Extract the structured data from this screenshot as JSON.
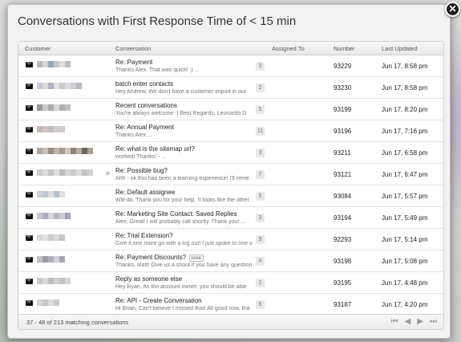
{
  "modal": {
    "title": "Conversations with First Response Time of < 15 min",
    "close_glyph": "✕"
  },
  "table": {
    "headers": {
      "customer": "Customer",
      "conversation": "Conversation",
      "assigned_to": "Assigned To",
      "number": "Number",
      "last_updated": "Last Updated"
    },
    "rows": [
      {
        "subject": "Re: Payment",
        "preview": "Thanks Alex. That was quick! :) ...",
        "count": "3",
        "number": "93229",
        "updated": "Jun 17, 8:58 pm",
        "customer_colors": [
          "#b8b8b8",
          "#d6d6d6",
          "#9aa6b8",
          "#c9c9c9",
          "#dedede",
          "#bcbcbc"
        ]
      },
      {
        "subject": "batch enter contacts",
        "preview": "Hey Andrew, We don't have a customer import in our",
        "count": "2",
        "number": "93230",
        "updated": "Jun 17, 8:58 pm",
        "customer_colors": [
          "#c7c7d6",
          "#d9d9d9",
          "#b6b0c2",
          "#e2e2e2",
          "#c8c8c8",
          "#dddddd",
          "#cfcfcf",
          "#b8b8c8"
        ]
      },
      {
        "subject": "Recent conversations",
        "preview": "You're always welcome :) Best Regards, Leonardo D",
        "count": "5",
        "number": "93199",
        "updated": "Jun 17, 8:20 pm",
        "customer_colors": [
          "#9a9a9a",
          "#cacaca",
          "#a9a9a9",
          "#d8d8d8",
          "#b3b3b3",
          "#c1c1c1"
        ]
      },
      {
        "subject": "Re: Annual Payment",
        "preview": "Thanks Alex ...",
        "count": "11",
        "number": "93196",
        "updated": "Jun 17, 7:16 pm",
        "customer_colors": [
          "#c7b8b8",
          "#d2c3c3",
          "#bfbfbf",
          "#cfcfcf",
          "#d9c9c9"
        ]
      },
      {
        "subject": "Re: what is the sitemap url?",
        "preview": "worked! Thanks! - ...",
        "count": "3",
        "number": "93211",
        "updated": "Jun 17, 6:58 pm",
        "customer_colors": [
          "#b0a8a0",
          "#c8c0b8",
          "#9a8f86",
          "#bfb5aa",
          "#a59a8f",
          "#cfc6bd",
          "#8f857b",
          "#b7ada3",
          "#6f655c",
          "#a99f95"
        ]
      },
      {
        "subject": "Re: Possible bug?",
        "preview": "Ahh - ok this has been a learning experience! I'll reme",
        "count": "7",
        "number": "93121",
        "updated": "Jun 17, 6:47 pm",
        "customer_colors": [
          "#cfcfcf",
          "#dadada",
          "#c5c5c5",
          "#e0e0e0",
          "#bebebe",
          "#d7d7d7",
          "#cacaca",
          "#dedede",
          "#c3c3c3",
          "#d1d1d1"
        ]
      },
      {
        "subject": "Re: Default assignee",
        "preview": "Will-do. Thank you for your help. It looks like the other",
        "count": "5",
        "number": "93084",
        "updated": "Jun 17, 5:57 pm",
        "customer_colors": [
          "#d0d0d0",
          "#c0c8d8",
          "#dcdcdc",
          "#b8c0d0",
          "#e0e0e0"
        ]
      },
      {
        "subject": "Re: Marketing Site Contact: Saved Replies",
        "preview": "Alex, Great! I will probably call shortly. Thank you! ...",
        "count": "3",
        "number": "93194",
        "updated": "Jun 17, 5:49 pm",
        "customer_colors": [
          "#c8c8c8",
          "#a8b0c0",
          "#d5d5d5",
          "#b5b5c5",
          "#cbcbcb",
          "#9ea6b6"
        ]
      },
      {
        "subject": "Re: Trial Extension?",
        "preview": "Give it one more go with a log out! I just spoke to one o",
        "count": "9",
        "number": "92293",
        "updated": "Jun 17, 5:14 pm",
        "customer_colors": [
          "#d6d6d6",
          "#e1e1e1",
          "#cbcbcb",
          "#dadada",
          "#c4c4c4"
        ]
      },
      {
        "subject": "Re: Payment Discounts?",
        "tag": "love",
        "preview": "Thanks, Matt! Give us a shout if you have any question",
        "count": "4",
        "number": "93198",
        "updated": "Jun 17, 5:08 pm",
        "customer_colors": [
          "#c0c0c8",
          "#9a9aa8",
          "#b0b0bc",
          "#d0d0d8",
          "#a5a5b2"
        ]
      },
      {
        "subject": "Reply as someone else",
        "preview": "Hey Ryan, As the account owner, you should be able",
        "count": "2",
        "number": "93195",
        "updated": "Jun 17, 4:48 pm",
        "customer_colors": [
          "#c9c9c9",
          "#d8d8d8",
          "#bdbdbd",
          "#cfcfcf",
          "#c2c2c2",
          "#d5d5d5"
        ]
      },
      {
        "subject": "Re: API - Create Conversation",
        "preview": "Hi Brian, Can't believe I missed that! All good now, tha",
        "count": "5",
        "number": "93187",
        "updated": "Jun 17, 4:20 pm",
        "customer_colors": [
          "#d4d4d4",
          "#c7c7c7",
          "#dddddd",
          "#cacaca"
        ]
      }
    ]
  },
  "footer": {
    "summary": "37 - 48 of 213 matching conversations",
    "first_glyph": "⏮",
    "prev_glyph": "◀",
    "next_glyph": "▶",
    "last_glyph": "⏭"
  }
}
